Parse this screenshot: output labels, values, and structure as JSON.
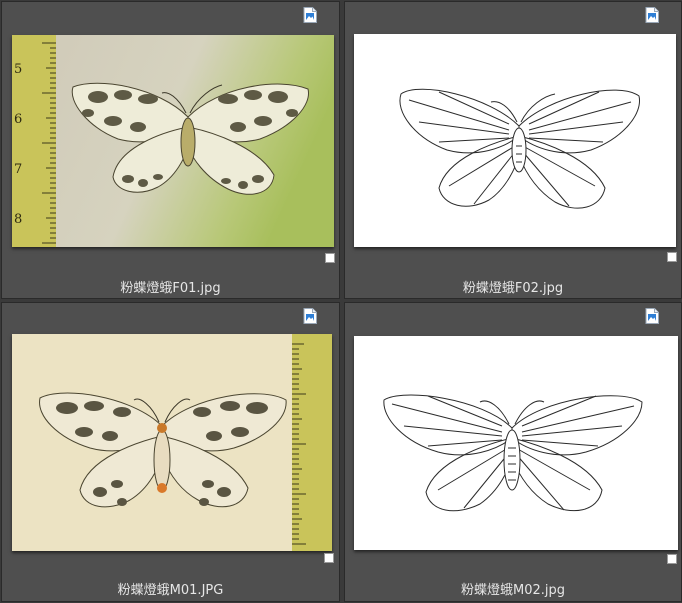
{
  "tiles": [
    {
      "filename": "粉蝶燈蛾F01.jpg",
      "ruler_labels": [
        "5",
        "6",
        "7",
        "8"
      ],
      "icon": "image-file-icon",
      "selected": false
    },
    {
      "filename": "粉蝶燈蛾F02.jpg",
      "icon": "image-file-icon",
      "selected": false
    },
    {
      "filename": "粉蝶燈蛾M01.JPG",
      "icon": "image-file-icon",
      "selected": false
    },
    {
      "filename": "粉蝶燈蛾M02.jpg",
      "icon": "image-file-icon",
      "selected": false
    }
  ]
}
